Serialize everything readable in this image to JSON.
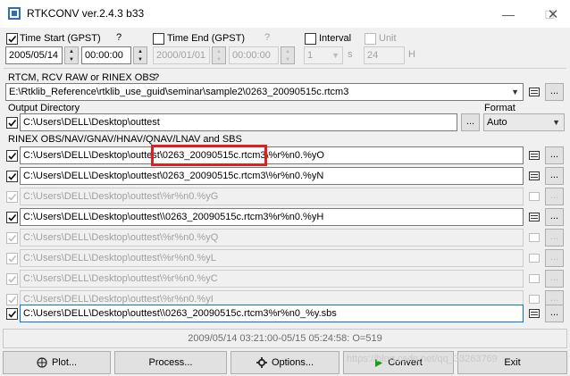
{
  "window": {
    "title": "RTKCONV ver.2.4.3 b33"
  },
  "time": {
    "start_label": "Time Start (GPST)",
    "start_help": "?",
    "start_date": "2005/05/14",
    "start_time": "00:00:00",
    "end_label": "Time End (GPST)",
    "end_help": "?",
    "end_date": "2000/01/01",
    "end_time": "00:00:00",
    "interval_label": "Interval",
    "interval_value": "1",
    "interval_unit": "s",
    "unit_label": "Unit",
    "unit_value": "24",
    "unit_suffix": "H"
  },
  "input": {
    "label": "RTCM, RCV RAW or RINEX OBS",
    "help": "?",
    "path": "E:\\Rtklib_Reference\\rtklib_use_guid\\seminar\\sample2\\0263_20090515c.rtcm3"
  },
  "output": {
    "label": "Output Directory",
    "path": "C:\\Users\\DELL\\Desktop\\outtest",
    "format_label": "Format",
    "format_value": "Auto"
  },
  "rinex": {
    "label": "RINEX OBS/NAV/GNAV/HNAV/QNAV/LNAV and SBS",
    "rows": [
      {
        "prefix": "C:\\Users\\DELL\\Desktop\\outtest",
        "highlight": "\\0263_20090515c.rtcm3",
        "suffix": "\\%r%n0.%yO"
      },
      {
        "path": "C:\\Users\\DELL\\Desktop\\outtest\\0263_20090515c.rtcm3\\%r%n0.%yN"
      },
      {
        "path": "C:\\Users\\DELL\\Desktop\\outtest\\%r%n0.%yG"
      },
      {
        "path": "C:\\Users\\DELL\\Desktop\\outtest\\\\0263_20090515c.rtcm3%r%n0.%yH"
      },
      {
        "path": "C:\\Users\\DELL\\Desktop\\outtest\\%r%n0.%yQ"
      },
      {
        "path": "C:\\Users\\DELL\\Desktop\\outtest\\%r%n0.%yL"
      },
      {
        "path": "C:\\Users\\DELL\\Desktop\\outtest\\%r%n0.%yC"
      },
      {
        "path": "C:\\Users\\DELL\\Desktop\\outtest\\%r%n0.%yI"
      },
      {
        "path": "C:\\Users\\DELL\\Desktop\\outtest\\\\0263_20090515c.rtcm3%r%n0_%y.sbs"
      }
    ]
  },
  "status": {
    "text": "2009/05/14 03:21:00-05/15 05:24:58: O=519"
  },
  "buttons": {
    "plot": "Plot...",
    "process": "Process...",
    "options": "Options...",
    "convert": "Convert",
    "exit": "Exit"
  },
  "watermark": "https://blog.csdn.net/qq_33263769",
  "dots_label": "...",
  "colors": {
    "accent": "#0078d7",
    "highlight_box": "#e02020",
    "convert_icon": "#1a9e1a"
  }
}
